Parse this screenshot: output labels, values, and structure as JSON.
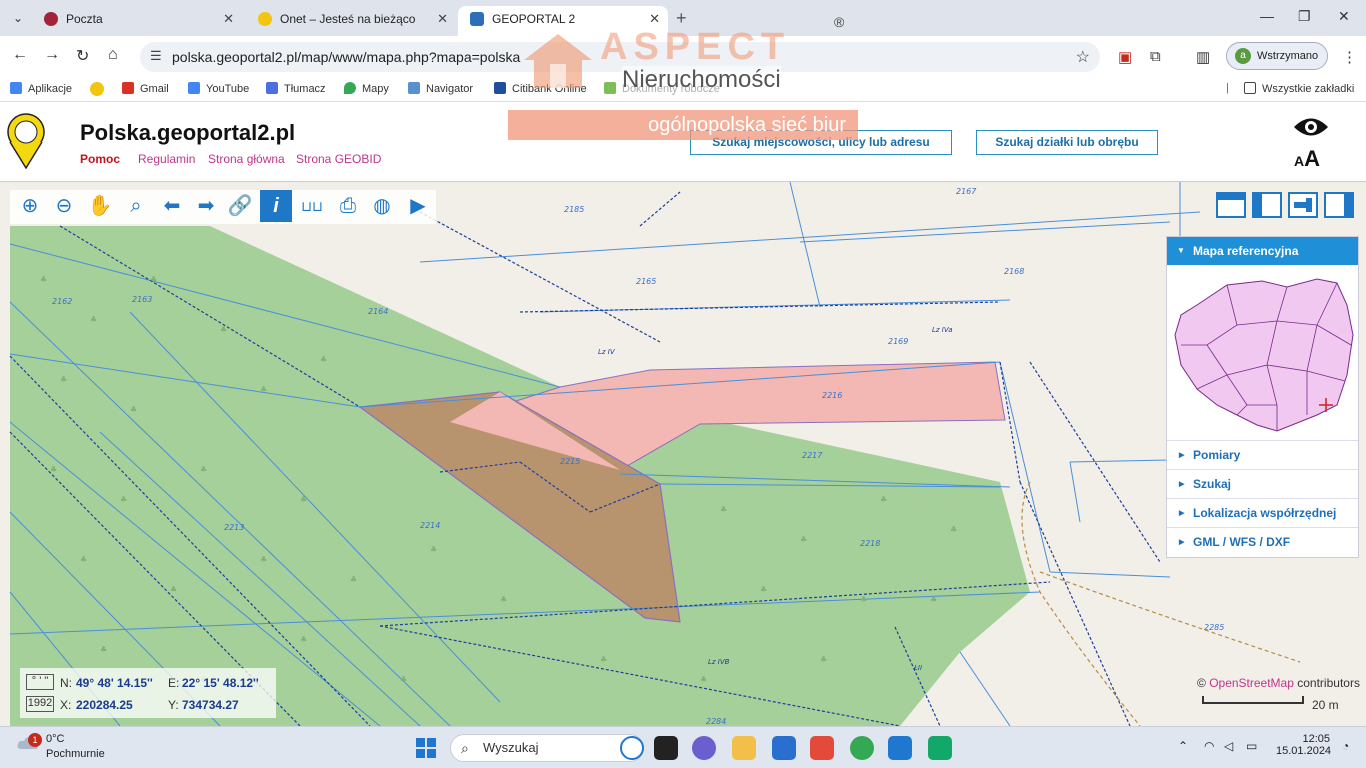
{
  "browser": {
    "tabs": [
      {
        "title": "Poczta",
        "active": false,
        "favicon_color": "#a3243a"
      },
      {
        "title": "Onet – Jesteś na bieżąco",
        "active": false,
        "favicon_color": "#f2c511"
      },
      {
        "title": "GEOPORTAL 2",
        "active": true,
        "favicon_color": "#2c6fb8"
      }
    ],
    "url": "polska.geoportal2.pl/map/www/mapa.php?mapa=polska",
    "profile": {
      "initial": "a",
      "label": "Wstrzymano"
    },
    "bookmarks": [
      {
        "label": "Aplikacje",
        "color": "#4285f4"
      },
      {
        "label": "",
        "color": "#f2c511"
      },
      {
        "label": "Gmail",
        "color": "#d93025"
      },
      {
        "label": "YouTube",
        "color": "#4285f4"
      },
      {
        "label": "Tłumacz",
        "color": "#4c6fe0"
      },
      {
        "label": "Mapy",
        "color": "#34a853"
      },
      {
        "label": "Navigator",
        "color": "#5a8fd0"
      },
      {
        "label": "Citibank Online",
        "color": "#1f4f9a"
      },
      {
        "label": "Dokumenty robocze",
        "color": "#7cbf5a"
      }
    ],
    "all_bookmarks": "Wszystkie zakładki"
  },
  "watermark": {
    "brand": "ASPECT",
    "reg": "®",
    "line1": "Nieruchomości",
    "line2": "ogólnopolska sieć biur"
  },
  "header": {
    "logo_text": "GEOBID",
    "title": "Polska.geoportal2.pl",
    "nav": [
      "Pomoc",
      "Regulamin",
      "Strona główna",
      "Strona GEOBID"
    ],
    "search_address": "Szukaj miejscowości, ulicy lub adresu",
    "search_parcel": "Szukaj działki lub obrębu",
    "font_size_toggle": "AA"
  },
  "toolbar": {
    "tools": [
      "zoom-in-icon",
      "zoom-out-icon",
      "pan-hand-icon",
      "zoom-box-icon",
      "back-arrow-icon",
      "forward-arrow-icon",
      "link-icon",
      "info-icon",
      "measure-ruler-icon",
      "print-icon",
      "globe-icon",
      "video-icon"
    ],
    "active_tool": "info-icon",
    "accent": "#1f77c8"
  },
  "map": {
    "parcel_labels": [
      "2185",
      "2167",
      "2165",
      "2168",
      "2162",
      "2163",
      "2164",
      "2169",
      "2216",
      "2215",
      "2217",
      "2213",
      "2214",
      "2218",
      "2285",
      "2284",
      "Lz IV",
      "Lz IVa",
      "Lz IVB",
      "ŁII"
    ],
    "forest_color": "#a6d09a",
    "parcel_highlight_color": "#f4b8b4",
    "parcel_overlap_color": "#b8946e",
    "boundary_color": "#4a8fd8"
  },
  "sidepanel": {
    "reference_map": "Mapa referencyjna",
    "items": [
      "Pomiary",
      "Szukaj",
      "Lokalizacja współrzędnej",
      "GML / WFS / DXF"
    ]
  },
  "coords": {
    "format_btn": "° ' \"",
    "system_btn": "1992",
    "n_label": "N:",
    "n_value": "49° 48' 14.15''",
    "e_label": "E:",
    "e_value": "22° 15' 48.12''",
    "x_label": "X:",
    "x_value": "220284.25",
    "y_label": "Y:",
    "y_value": "734734.27"
  },
  "attribution": {
    "symbol": "©",
    "link": "OpenStreetMap",
    "text": "contributors"
  },
  "scale_label": "20 m",
  "taskbar": {
    "weather_temp": "0°C",
    "weather_cond": "Pochmurnie",
    "weather_badge": "1",
    "search": "Wyszukaj",
    "time": "12:05",
    "date": "15.01.2024"
  }
}
